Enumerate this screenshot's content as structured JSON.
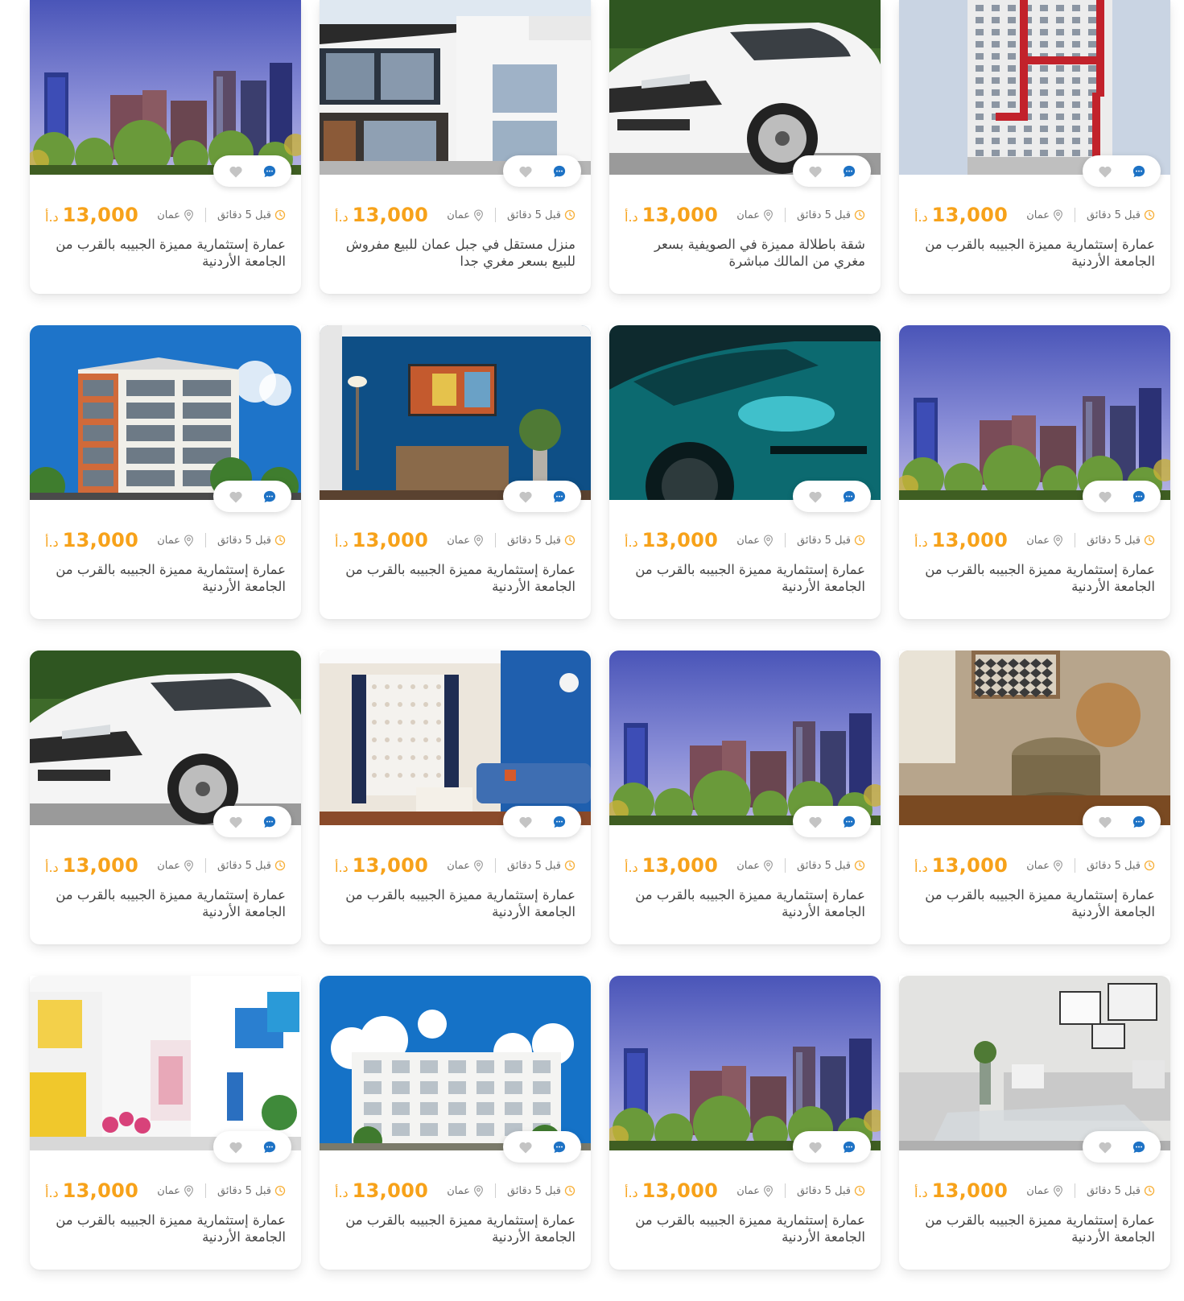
{
  "listings": [
    {
      "photo": "city-skyline",
      "time": "قبل 5 دقائق",
      "location": "عمان",
      "price": "13,000",
      "currency": "د.أ",
      "title": "عمارة إستثمارية مميزة الجبيبه بالقرب من الجامعة الأردنية"
    },
    {
      "photo": "modern-house",
      "time": "قبل 5 دقائق",
      "location": "عمان",
      "price": "13,000",
      "currency": "د.أ",
      "title": "منزل مستقل في جبل عمان للبيع مفروش للبيع بسعر مغري جدا"
    },
    {
      "photo": "white-suv",
      "time": "قبل 5 دقائق",
      "location": "عمان",
      "price": "13,000",
      "currency": "د.أ",
      "title": "شقة باطلالة مميزة في الصويفية بسعر مغري من المالك مباشرة"
    },
    {
      "photo": "tower-red",
      "time": "قبل 5 دقائق",
      "location": "عمان",
      "price": "13,000",
      "currency": "د.أ",
      "title": "عمارة إستثمارية مميزة الجبيبه بالقرب من الجامعة الأردنية"
    },
    {
      "photo": "apartment-block",
      "time": "قبل 5 دقائق",
      "location": "عمان",
      "price": "13,000",
      "currency": "د.أ",
      "title": "عمارة إستثمارية مميزة الجبيبه بالقرب من الجامعة الأردنية"
    },
    {
      "photo": "blue-living-room",
      "time": "قبل 5 دقائق",
      "location": "عمان",
      "price": "13,000",
      "currency": "د.أ",
      "title": "عمارة إستثمارية مميزة الجبيبه بالقرب من الجامعة الأردنية"
    },
    {
      "photo": "teal-sports-car",
      "time": "قبل 5 دقائق",
      "location": "عمان",
      "price": "13,000",
      "currency": "د.أ",
      "title": "عمارة إستثمارية مميزة الجبيبه بالقرب من الجامعة الأردنية"
    },
    {
      "photo": "city-skyline",
      "time": "قبل 5 دقائق",
      "location": "عمان",
      "price": "13,000",
      "currency": "د.أ",
      "title": "عمارة إستثمارية مميزة الجبيبه بالقرب من الجامعة الأردنية"
    },
    {
      "photo": "white-suv",
      "time": "قبل 5 دقائق",
      "location": "عمان",
      "price": "13,000",
      "currency": "د.أ",
      "title": "عمارة إستثمارية مميزة الجبيبه بالقرب من الجامعة الأردنية"
    },
    {
      "photo": "bright-living-room",
      "time": "قبل 5 دقائق",
      "location": "عمان",
      "price": "13,000",
      "currency": "د.أ",
      "title": "عمارة إستثمارية مميزة الجبيبه بالقرب من الجامعة الأردنية"
    },
    {
      "photo": "city-skyline",
      "time": "قبل 5 دقائق",
      "location": "عمان",
      "price": "13,000",
      "currency": "د.أ",
      "title": "عمارة إستثمارية مميزة الجبيبه بالقرب من الجامعة الأردنية"
    },
    {
      "photo": "cozy-corner",
      "time": "قبل 5 دقائق",
      "location": "عمان",
      "price": "13,000",
      "currency": "د.أ",
      "title": "عمارة إستثمارية مميزة الجبيبه بالقرب من الجامعة الأردنية"
    },
    {
      "photo": "colorful-street",
      "time": "قبل 5 دقائق",
      "location": "عمان",
      "price": "13,000",
      "currency": "د.أ",
      "title": "عمارة إستثمارية مميزة الجبيبه بالقرب من الجامعة الأردنية"
    },
    {
      "photo": "white-building",
      "time": "قبل 5 دقائق",
      "location": "عمان",
      "price": "13,000",
      "currency": "د.أ",
      "title": "عمارة إستثمارية مميزة الجبيبه بالقرب من الجامعة الأردنية"
    },
    {
      "photo": "city-skyline",
      "time": "قبل 5 دقائق",
      "location": "عمان",
      "price": "13,000",
      "currency": "د.أ",
      "title": "عمارة إستثمارية مميزة الجبيبه بالقرب من الجامعة الأردنية"
    },
    {
      "photo": "grey-living-room",
      "time": "قبل 5 دقائق",
      "location": "عمان",
      "price": "13,000",
      "currency": "د.أ",
      "title": "عمارة إستثمارية مميزة الجبيبه بالقرب من الجامعة الأردنية"
    }
  ],
  "icons": {
    "favorite": "heart-icon",
    "chat": "chat-bubble-icon",
    "time": "clock-icon",
    "location": "location-pin-icon"
  },
  "colors": {
    "price": "#f7a21a",
    "chat_icon": "#1d72c5",
    "heart_icon": "#c4c4c4",
    "clock_icon": "#f7b03a",
    "meta_text": "#6f6f6f",
    "title_text": "#444444"
  }
}
